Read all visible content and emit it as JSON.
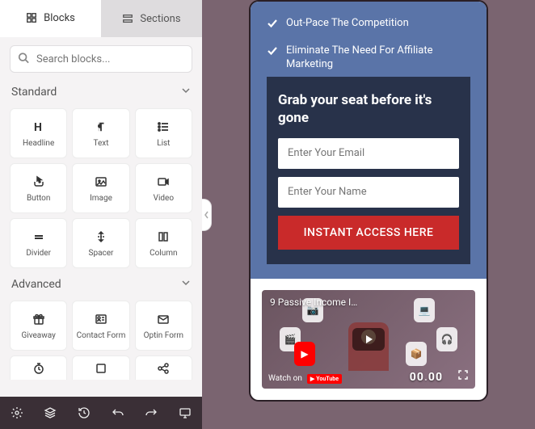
{
  "tabs": {
    "blocks": "Blocks",
    "sections": "Sections"
  },
  "search": {
    "placeholder": "Search blocks..."
  },
  "groups": {
    "standard": {
      "title": "Standard",
      "items": [
        {
          "label": "Headline"
        },
        {
          "label": "Text"
        },
        {
          "label": "List"
        },
        {
          "label": "Button"
        },
        {
          "label": "Image"
        },
        {
          "label": "Video"
        },
        {
          "label": "Divider"
        },
        {
          "label": "Spacer"
        },
        {
          "label": "Column"
        }
      ]
    },
    "advanced": {
      "title": "Advanced",
      "items": [
        {
          "label": "Giveaway"
        },
        {
          "label": "Contact Form"
        },
        {
          "label": "Optin Form"
        }
      ]
    }
  },
  "preview": {
    "bullets": [
      "Out-Pace The Competition",
      "Eliminate The Need For Affiliate Marketing"
    ],
    "form": {
      "title": "Grab your seat before it's gone",
      "email_placeholder": "Enter Your Email",
      "name_placeholder": "Enter Your Name",
      "cta": "INSTANT ACCESS HERE"
    },
    "video": {
      "title": "9 Passive Income I…",
      "watch_on": "Watch on",
      "platform": "YouTube",
      "time": "00"
    }
  }
}
